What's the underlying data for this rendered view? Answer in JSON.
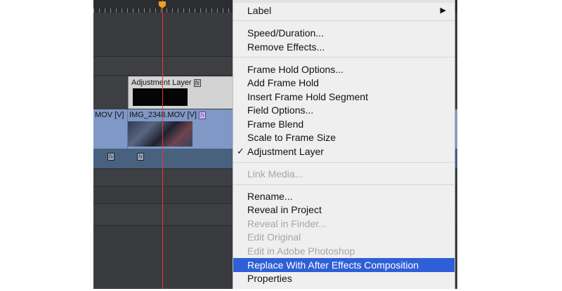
{
  "timeline": {
    "adjustment_clip_label": "Adjustment Layer",
    "fx_badge": "fx",
    "clip_left_label": "MOV [V]",
    "clip_right_label": "IMG_2348.MOV [V]"
  },
  "context_menu": {
    "items": [
      {
        "label": "Label",
        "enabled": true,
        "submenu": true
      },
      {
        "label": "Speed/Duration...",
        "enabled": true
      },
      {
        "label": "Remove Effects...",
        "enabled": true
      },
      {
        "label": "Frame Hold Options...",
        "enabled": true
      },
      {
        "label": "Add Frame Hold",
        "enabled": true
      },
      {
        "label": "Insert Frame Hold Segment",
        "enabled": true
      },
      {
        "label": "Field Options...",
        "enabled": true
      },
      {
        "label": "Frame Blend",
        "enabled": true
      },
      {
        "label": "Scale to Frame Size",
        "enabled": true
      },
      {
        "label": "Adjustment Layer",
        "enabled": true,
        "checked": true
      },
      {
        "label": "Link Media...",
        "enabled": false
      },
      {
        "label": "Rename...",
        "enabled": true
      },
      {
        "label": "Reveal in Project",
        "enabled": true
      },
      {
        "label": "Reveal in Finder...",
        "enabled": false
      },
      {
        "label": "Edit Original",
        "enabled": false
      },
      {
        "label": "Edit in Adobe Photoshop",
        "enabled": false
      },
      {
        "label": "Replace With After Effects Composition",
        "enabled": true,
        "highlighted": true
      },
      {
        "label": "Properties",
        "enabled": true
      }
    ],
    "check_glyph": "✓",
    "submenu_glyph": "▶"
  },
  "colors": {
    "highlight": "#2f5fd7",
    "playhead": "#e63a2e",
    "video_clip": "#7f98c6"
  }
}
